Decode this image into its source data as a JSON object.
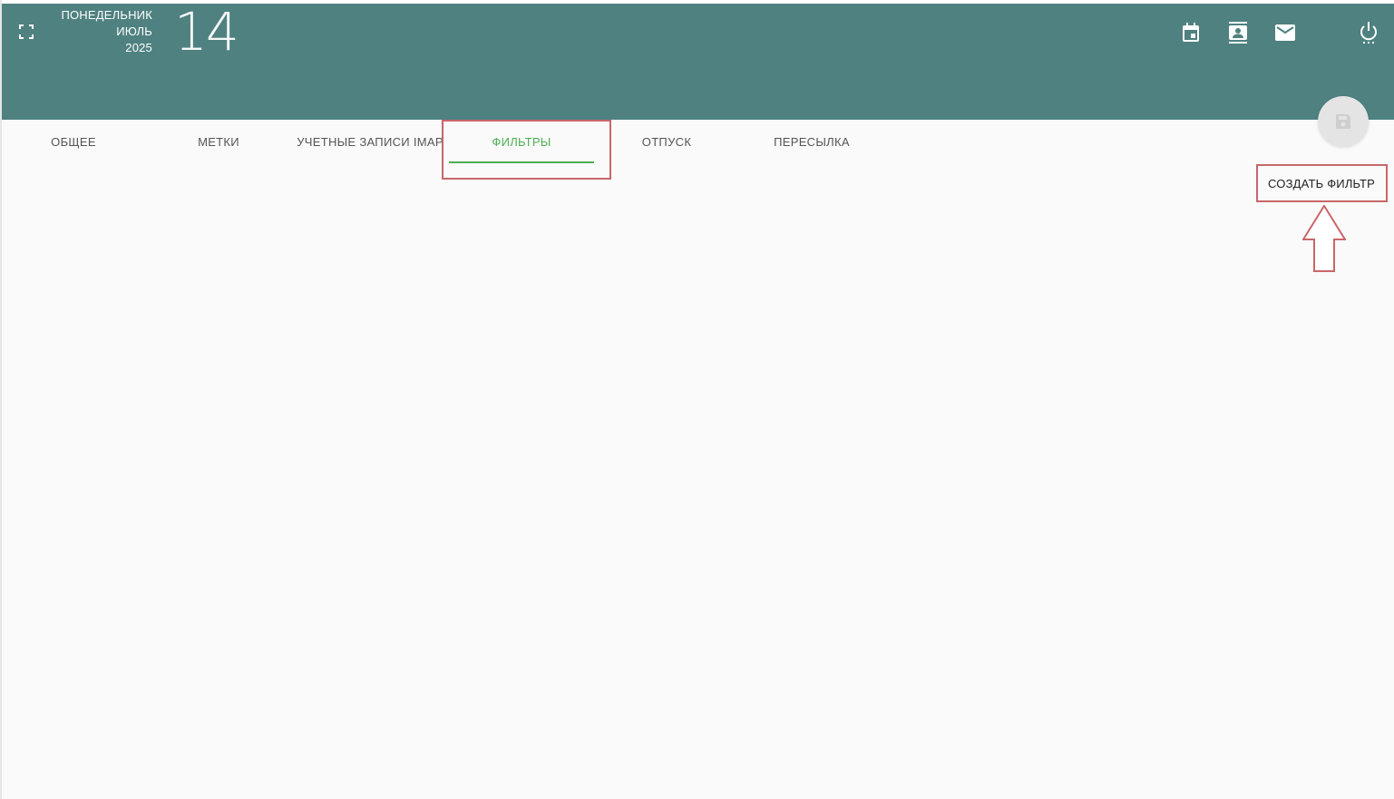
{
  "header": {
    "weekday": "ПОНЕДЕЛЬНИК",
    "month": "ИЮЛЬ",
    "year": "2025",
    "day": "14",
    "background_color": "#4f8180",
    "icons": [
      "fullscreen-icon",
      "calendar-icon",
      "contacts-icon",
      "mail-icon",
      "power-icon"
    ]
  },
  "tabs": [
    {
      "label": "ОБЩЕЕ",
      "active": false
    },
    {
      "label": "МЕТКИ",
      "active": false
    },
    {
      "label": "УЧЕТНЫЕ ЗАПИСИ IMAP",
      "active": false
    },
    {
      "label": "ФИЛЬТРЫ",
      "active": true
    },
    {
      "label": "ОТПУСК",
      "active": false
    },
    {
      "label": "ПЕРЕСЫЛКА",
      "active": false
    }
  ],
  "active_tab_color": "#4caf50",
  "actions": {
    "create_filter": "СОЗДАТЬ ФИЛЬТР",
    "save_icon": "save-icon"
  },
  "annotation_color": "#c9666a"
}
